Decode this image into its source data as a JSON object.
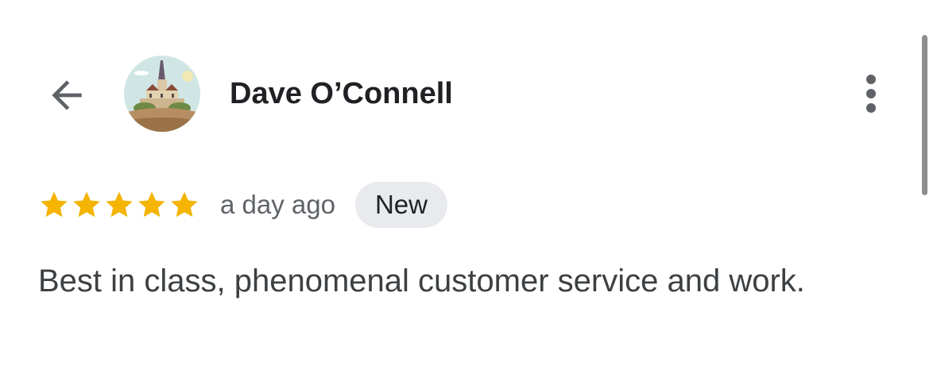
{
  "header": {
    "author_name": "Dave O’Connell",
    "back_icon": "arrow-left-icon",
    "more_icon": "more-vertical-icon",
    "avatar_icon": "castle-avatar"
  },
  "review": {
    "rating": 5,
    "rating_max": 5,
    "time_ago": "a day ago",
    "badge": "New",
    "text": "Best in class, phenomenal customer service and work."
  },
  "colors": {
    "star": "#F4B400",
    "badge_bg": "#E8EAED",
    "name": "#202124",
    "secondary_text": "#5F6368",
    "body_text": "#3C4043"
  }
}
